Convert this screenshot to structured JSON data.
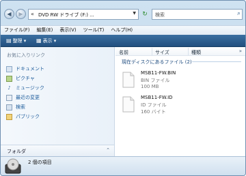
{
  "address": {
    "path": "DVD RW ドライブ (F:) ...",
    "search_placeholder": "検索"
  },
  "menu": [
    "ファイル(F)",
    "編集(E)",
    "表示(V)",
    "ツール(T)",
    "ヘルプ(H)"
  ],
  "toolbar": {
    "organize": "整理",
    "view": "表示"
  },
  "navpane": {
    "title": "お気に入りリンク",
    "items": [
      "ドキュメント",
      "ピクチャ",
      "ミュージック",
      "最近の変更",
      "検索",
      "パブリック"
    ],
    "folders_label": "フォルダ"
  },
  "columns": [
    "名前",
    "サイズ",
    "種類"
  ],
  "group_label": "現在ディスクにあるファイル (2)",
  "files": [
    {
      "name": "MSB11-FW.BIN",
      "type": "BIN ファイル",
      "size": "100 MB"
    },
    {
      "name": "MSB11-FW.ID",
      "type": "ID ファイル",
      "size": "160 バイト"
    }
  ],
  "details": {
    "count": "2 個の項目"
  },
  "colors": {
    "toolbar": "#2b5c8c",
    "link": "#1c5b9b"
  }
}
